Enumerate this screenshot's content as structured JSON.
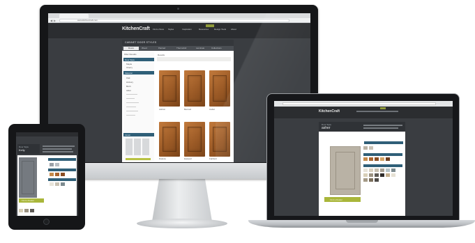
{
  "desktop": {
    "url": "www.kitchencraft.com",
    "brand": "KitchenCraft",
    "nav": [
      "Find a Store",
      "Styles",
      "Inspiration",
      "Resources",
      "Design Tools",
      "About"
    ],
    "page_title": "CABINET DOOR STYLES",
    "tabs": [
      "Doors",
      "Wood",
      "Painted",
      "Thermofoil",
      "Laminate",
      "Collections"
    ],
    "breadcrumb": "Filter Results",
    "results_label": "Results",
    "sidebar_sections": [
      "Door Style",
      "Material",
      "Finish"
    ],
    "sidebar_items": [
      "Maple",
      "Cherry",
      "Oak",
      "Hickory",
      "Birch",
      "Alder"
    ],
    "doors": [
      {
        "name": "Ashton"
      },
      {
        "name": "Bennett"
      },
      {
        "name": "Cabot"
      },
      {
        "name": "Dakota"
      },
      {
        "name": "Eastport"
      },
      {
        "name": "Fairfield"
      }
    ]
  },
  "laptop": {
    "brand": "KitchenCraft",
    "style_label": "Door Style",
    "style_name": "asher",
    "cta": "Find a Dealer"
  },
  "tablet": {
    "style_label": "Door Style",
    "style_name": "Kelly",
    "cta": "Find a Dealer"
  },
  "colors": {
    "page_bg": "#ffffff",
    "screen_bg": "#3a3d41",
    "header": "#2b2d30",
    "accent_teal": "#2f5f78",
    "accent_green": "#a9b63a",
    "wood": "#a8642c",
    "painted_door": "#b9b2a5"
  },
  "icons": [
    "camera-icon",
    "home-button-icon",
    "back-icon",
    "forward-icon"
  ]
}
